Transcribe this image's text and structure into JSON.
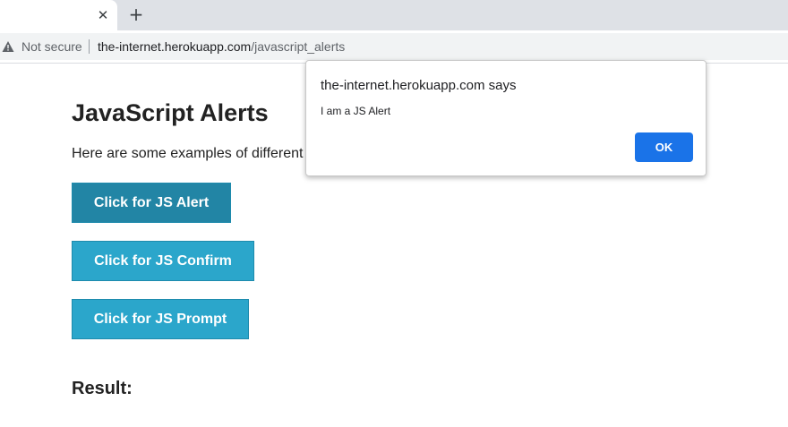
{
  "browser": {
    "tab_close_glyph": "✕",
    "new_tab_glyph": "+",
    "security_label": "Not secure",
    "url_host": "the-internet.herokuapp.com",
    "url_path": "/javascript_alerts"
  },
  "page": {
    "title": "JavaScript Alerts",
    "description": "Here are some examples of different",
    "buttons": {
      "alert": "Click for JS Alert",
      "confirm": "Click for JS Confirm",
      "prompt": "Click for JS Prompt"
    },
    "result_label": "Result:"
  },
  "dialog": {
    "title": "the-internet.herokuapp.com says",
    "message": "I am a JS Alert",
    "ok_label": "OK"
  },
  "colors": {
    "button": "#2ba6cb",
    "button_active": "#2285a5",
    "dialog_ok": "#1a73e8",
    "tabstrip": "#dee1e6"
  },
  "icons": {
    "security": "warning-triangle-icon"
  }
}
